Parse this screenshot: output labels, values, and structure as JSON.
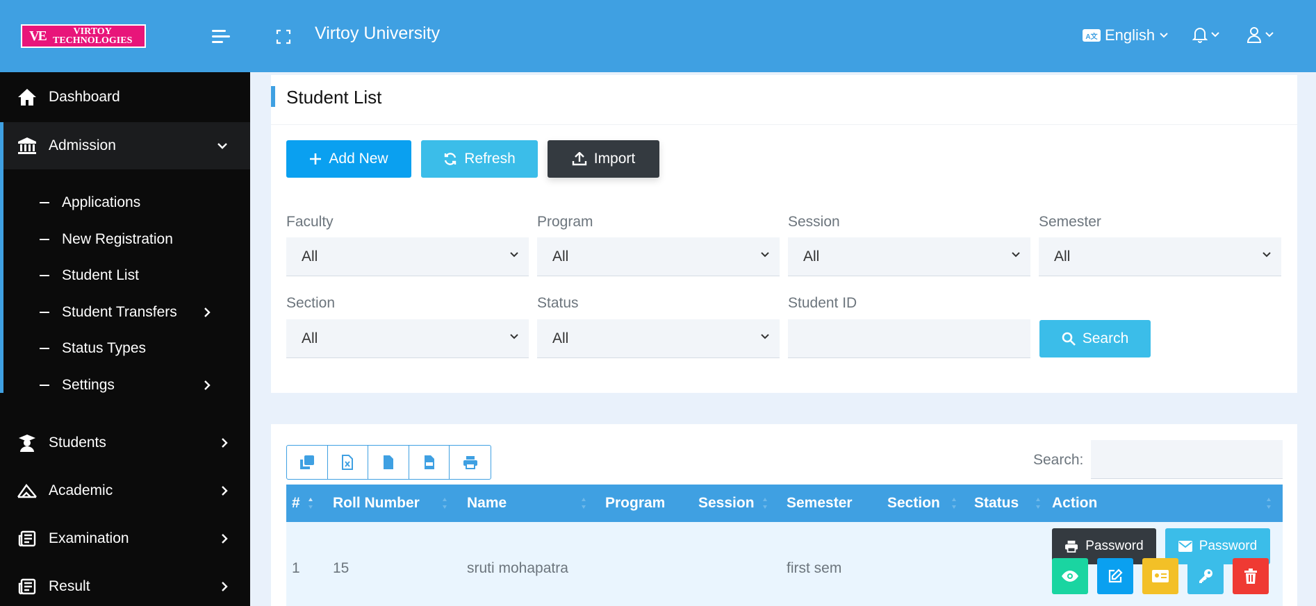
{
  "header": {
    "logo_mark": "VE",
    "logo_line1": "VIRTOY",
    "logo_line2": "TECHNOLOGIES",
    "app_title": "Virtoy University",
    "language": "English",
    "language_badge": "A文"
  },
  "sidebar": {
    "items": [
      {
        "label": "Dashboard",
        "icon": "home-icon"
      },
      {
        "label": "Admission",
        "icon": "bank-icon"
      },
      {
        "label": "Students",
        "icon": "graduate-icon"
      },
      {
        "label": "Academic",
        "icon": "academic-icon"
      },
      {
        "label": "Examination",
        "icon": "newspaper-icon"
      },
      {
        "label": "Result",
        "icon": "newspaper-icon"
      }
    ],
    "submenu": [
      {
        "label": "Applications"
      },
      {
        "label": "New Registration"
      },
      {
        "label": "Student List"
      },
      {
        "label": "Student Transfers"
      },
      {
        "label": "Status Types"
      },
      {
        "label": "Settings"
      }
    ]
  },
  "page": {
    "title": "Student List",
    "buttons": {
      "add": "Add New",
      "refresh": "Refresh",
      "import": "Import"
    },
    "filters": {
      "faculty": {
        "label": "Faculty",
        "value": "All"
      },
      "program": {
        "label": "Program",
        "value": "All"
      },
      "session": {
        "label": "Session",
        "value": "All"
      },
      "semester": {
        "label": "Semester",
        "value": "All"
      },
      "section": {
        "label": "Section",
        "value": "All"
      },
      "status": {
        "label": "Status",
        "value": "All"
      },
      "student_id": {
        "label": "Student ID",
        "value": ""
      }
    },
    "search_button": "Search"
  },
  "table": {
    "search_label": "Search:",
    "columns": [
      "#",
      "Roll Number",
      "Name",
      "Program",
      "Session",
      "Semester",
      "Section",
      "Status",
      "Action"
    ],
    "rows": [
      {
        "num": "1",
        "roll": "15",
        "name": "sruti mohapatra",
        "program": "",
        "session": "",
        "semester": "first sem",
        "section": "",
        "status": ""
      }
    ],
    "actions": {
      "print_password": "Password",
      "email_password": "Password"
    }
  },
  "colors": {
    "primary": "#3fa0e2",
    "sidebar": "#0b0b0b",
    "info": "#3bbde9",
    "success": "#1ad5a1",
    "warning": "#f3c027",
    "danger": "#ef3a33",
    "dark": "#343a40"
  }
}
